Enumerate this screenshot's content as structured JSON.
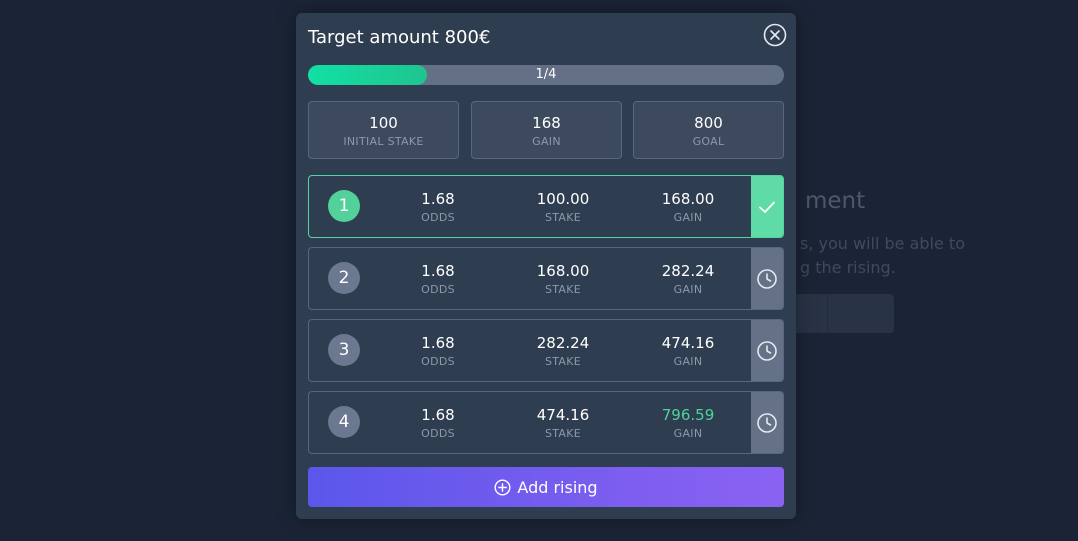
{
  "background": {
    "heading": "ment",
    "line1": "s, you will be able to",
    "line2": "g the rising."
  },
  "modal": {
    "title": "Target amount 800€",
    "progress": {
      "label": "1/4",
      "fraction": 0.25
    },
    "summary": [
      {
        "value": "100",
        "label": "INITIAL STAKE"
      },
      {
        "value": "168",
        "label": "GAIN"
      },
      {
        "value": "800",
        "label": "GOAL"
      }
    ],
    "labels": {
      "odds": "ODDS",
      "stake": "STAKE",
      "gain": "GAIN"
    },
    "rows": [
      {
        "number": "1",
        "odds": "1.68",
        "stake": "100.00",
        "gain": "168.00",
        "status": "done"
      },
      {
        "number": "2",
        "odds": "1.68",
        "stake": "168.00",
        "gain": "282.24",
        "status": "pending"
      },
      {
        "number": "3",
        "odds": "1.68",
        "stake": "282.24",
        "gain": "474.16",
        "status": "pending"
      },
      {
        "number": "4",
        "odds": "1.68",
        "stake": "474.16",
        "gain": "796.59",
        "status": "pending"
      }
    ],
    "add_button": "Add rising"
  },
  "colors": {
    "success": "#52d19a",
    "accent_start": "#5b57ea",
    "accent_end": "#8a62f2",
    "modal_bg": "#2f3d50",
    "page_bg": "#1b2436"
  }
}
